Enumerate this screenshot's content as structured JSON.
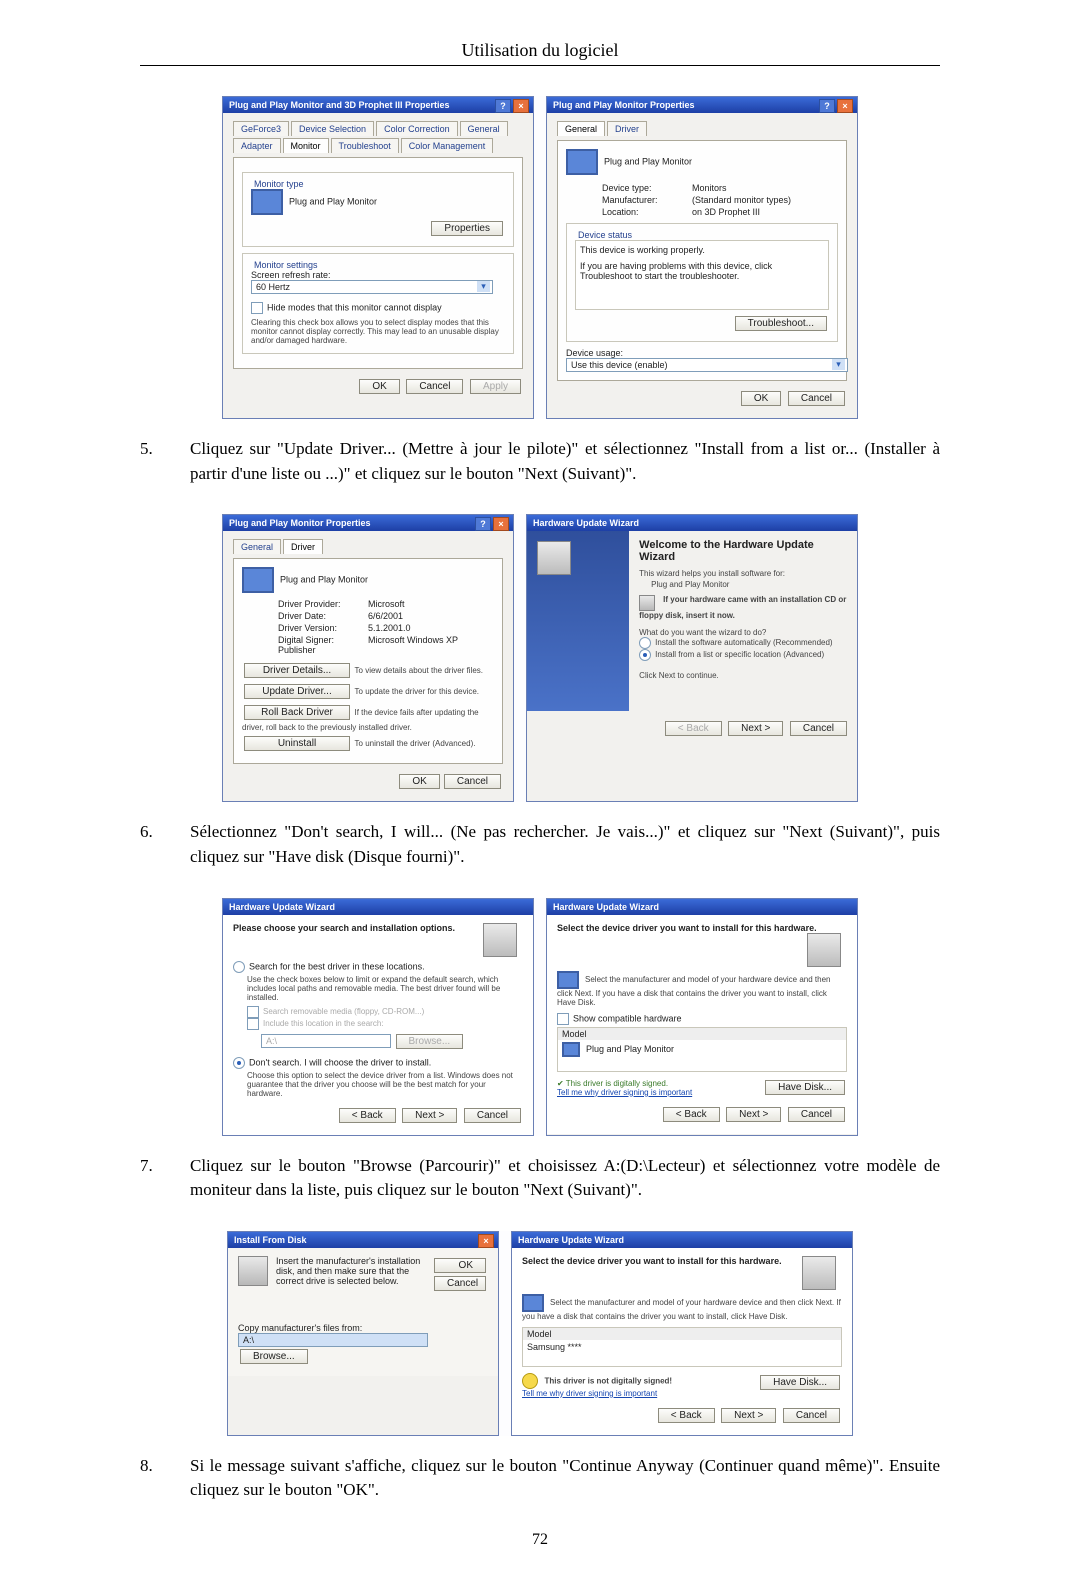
{
  "header": {
    "title": "Utilisation du logiciel"
  },
  "page_number": "72",
  "steps": {
    "s5": {
      "num": "5.",
      "text": "Cliquez sur \"Update Driver... (Mettre à jour le pilote)\" et sélectionnez \"Install from a list or... (Installer à partir d'une liste ou ...)\" et cliquez sur le bouton \"Next (Suivant)\"."
    },
    "s6": {
      "num": "6.",
      "text": "Sélectionnez \"Don't search, I will... (Ne pas rechercher. Je vais...)\" et cliquez sur \"Next (Suivant)\", puis cliquez sur \"Have disk (Disque fourni)\"."
    },
    "s7": {
      "num": "7.",
      "text": "Cliquez sur le bouton \"Browse (Parcourir)\" et choisissez A:(D:\\Lecteur) et sélectionnez votre modèle de moniteur dans la liste, puis cliquez sur le bouton \"Next (Suivant)\"."
    },
    "s8": {
      "num": "8.",
      "text": "Si le message suivant s'affiche, cliquez sur le bouton \"Continue Anyway (Continuer quand même)\". Ensuite cliquez sur le bouton \"OK\"."
    }
  },
  "common": {
    "ok": "OK",
    "cancel": "Cancel",
    "apply": "Apply",
    "back": "< Back",
    "next": "Next >",
    "browse": "Browse...",
    "have_disk": "Have Disk..."
  },
  "fig1": {
    "left": {
      "title": "Plug and Play Monitor and 3D Prophet III Properties",
      "tabs": [
        "GeForce3",
        "Device Selection",
        "Color Correction",
        "General",
        "Adapter",
        "Monitor",
        "Troubleshoot",
        "Color Management"
      ],
      "group_monitor_type": "Monitor type",
      "monitor_name": "Plug and Play Monitor",
      "properties_btn": "Properties",
      "group_monitor_settings": "Monitor settings",
      "refresh_label": "Screen refresh rate:",
      "refresh_value": "60 Hertz",
      "hide_modes": "Hide modes that this monitor cannot display",
      "hide_note": "Clearing this check box allows you to select display modes that this monitor cannot display correctly. This may lead to an unusable display and/or damaged hardware."
    },
    "right": {
      "title": "Plug and Play Monitor Properties",
      "tabs": [
        "General",
        "Driver"
      ],
      "header": "Plug and Play Monitor",
      "rows": {
        "dt_l": "Device type:",
        "dt_v": "Monitors",
        "mf_l": "Manufacturer:",
        "mf_v": "(Standard monitor types)",
        "lo_l": "Location:",
        "lo_v": "on 3D Prophet III"
      },
      "status_group": "Device status",
      "status_text": "This device is working properly.",
      "status_help": "If you are having problems with this device, click Troubleshoot to start the troubleshooter.",
      "troubleshoot": "Troubleshoot...",
      "usage_label": "Device usage:",
      "usage_value": "Use this device (enable)"
    }
  },
  "fig2": {
    "left": {
      "title": "Plug and Play Monitor Properties",
      "tabs": [
        "General",
        "Driver"
      ],
      "header": "Plug and Play Monitor",
      "rows": {
        "dp_l": "Driver Provider:",
        "dp_v": "Microsoft",
        "dd_l": "Driver Date:",
        "dd_v": "6/6/2001",
        "dv_l": "Driver Version:",
        "dv_v": "5.1.2001.0",
        "ds_l": "Digital Signer:",
        "ds_v": "Microsoft Windows XP Publisher"
      },
      "btn_details": "Driver Details...",
      "btn_details_t": "To view details about the driver files.",
      "btn_update": "Update Driver...",
      "btn_update_t": "To update the driver for this device.",
      "btn_roll": "Roll Back Driver",
      "btn_roll_t": "If the device fails after updating the driver, roll back to the previously installed driver.",
      "btn_uninst": "Uninstall",
      "btn_uninst_t": "To uninstall the driver (Advanced)."
    },
    "right": {
      "title": "Hardware Update Wizard",
      "h1": "Welcome to the Hardware Update Wizard",
      "p1": "This wizard helps you install software for:",
      "device": "Plug and Play Monitor",
      "cdnote": "If your hardware came with an installation CD or floppy disk, insert it now.",
      "q": "What do you want the wizard to do?",
      "opt1": "Install the software automatically (Recommended)",
      "opt2": "Install from a list or specific location (Advanced)",
      "cont": "Click Next to continue."
    }
  },
  "fig3": {
    "left": {
      "title": "Hardware Update Wizard",
      "heading": "Please choose your search and installation options.",
      "opt1": "Search for the best driver in these locations.",
      "opt1_sub": "Use the check boxes below to limit or expand the default search, which includes local paths and removable media. The best driver found will be installed.",
      "chk1": "Search removable media (floppy, CD-ROM...)",
      "chk2": "Include this location in the search:",
      "loc_value": "A:\\",
      "opt2": "Don't search. I will choose the driver to install.",
      "opt2_sub": "Choose this option to select the device driver from a list. Windows does not guarantee that the driver you choose will be the best match for your hardware."
    },
    "right": {
      "title": "Hardware Update Wizard",
      "heading": "Select the device driver you want to install for this hardware.",
      "sub": "Select the manufacturer and model of your hardware device and then click Next. If you have a disk that contains the driver you want to install, click Have Disk.",
      "show_compat": "Show compatible hardware",
      "model_label": "Model",
      "model_value": "Plug and Play Monitor",
      "signed": "This driver is digitally signed.",
      "tellme": "Tell me why driver signing is important"
    }
  },
  "fig4": {
    "left": {
      "title": "Install From Disk",
      "msg": "Insert the manufacturer's installation disk, and then make sure that the correct drive is selected below.",
      "copy_label": "Copy manufacturer's files from:",
      "path": "A:\\"
    },
    "right": {
      "title": "Hardware Update Wizard",
      "heading": "Select the device driver you want to install for this hardware.",
      "sub": "Select the manufacturer and model of your hardware device and then click Next. If you have a disk that contains the driver you want to install, click Have Disk.",
      "model_label": "Model",
      "model_value": "Samsung ****",
      "not_signed": "This driver is not digitally signed!",
      "tellme": "Tell me why driver signing is important"
    }
  }
}
